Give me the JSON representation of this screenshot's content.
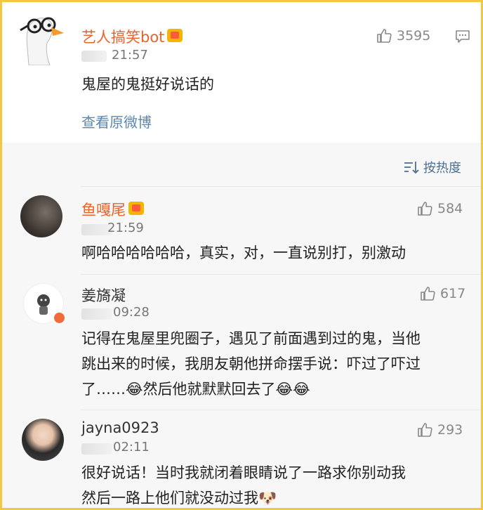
{
  "post": {
    "username": "艺人搞笑bot",
    "time": "21:57",
    "likes": "3595",
    "text": "鬼屋的鬼挺好说话的",
    "view_original": "查看原微博"
  },
  "sort": {
    "label": "按热度"
  },
  "comments": [
    {
      "username": "鱼嘎尾",
      "time": "21:59",
      "likes": "584",
      "text": "啊哈哈哈哈哈哈，真实，对，一直说别打，别激动"
    },
    {
      "username": "姜旖凝",
      "time": "09:28",
      "likes": "617",
      "line1": "记得在鬼屋里兜圈子，遇见了前面遇到过的鬼，当他",
      "line2": "跳出来的时候，我朋友朝他拼命摆手说：吓过了吓过",
      "line3": "了……😂然后他就默默回去了😂😂"
    },
    {
      "username": "jayna0923",
      "time": "02:11",
      "likes": "293",
      "line1": "很好说话！当时我就闭着眼睛说了一路求你别动我",
      "line2": "然后一路上他们就没动过我🐶"
    }
  ],
  "icons": {
    "like": "thumbs-up-icon",
    "comment": "comment-icon",
    "sort": "sort-icon",
    "vip": "vip-badge-icon"
  },
  "colors": {
    "border": "#f2c744",
    "username_highlight": "#e8632c",
    "link": "#5b86b0",
    "comments_bg": "#f7f7f7"
  }
}
